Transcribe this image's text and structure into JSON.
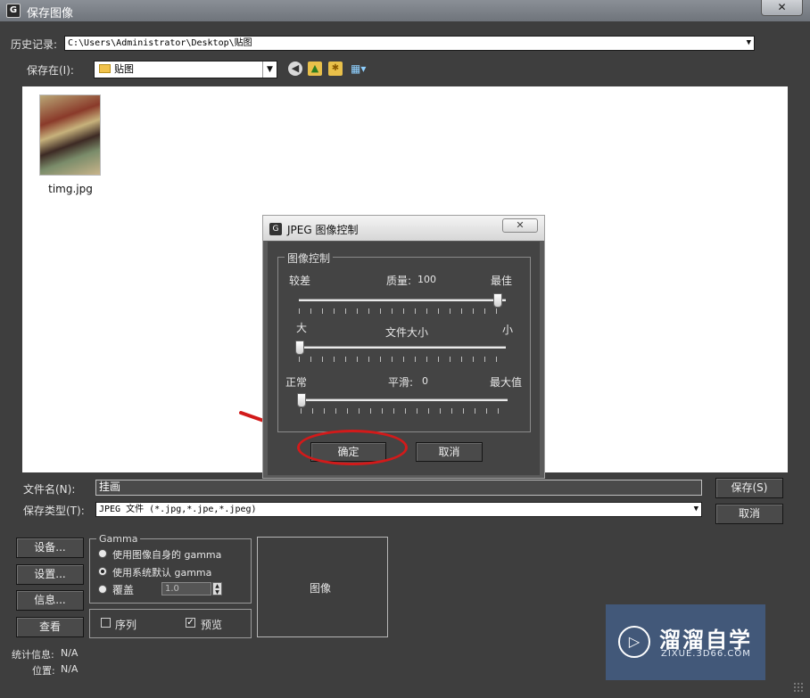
{
  "window": {
    "title": "保存图像",
    "close_glyph": "✕"
  },
  "history": {
    "label": "历史记录:",
    "value": "C:\\Users\\Administrator\\Desktop\\贴图"
  },
  "save_in": {
    "label": "保存在(I):",
    "value": "贴图"
  },
  "file": {
    "name": "timg.jpg"
  },
  "jpeg_dialog": {
    "title": "JPEG 图像控制",
    "close_glyph": "✕",
    "group_title": "图像控制",
    "quality": {
      "left_label": "较差",
      "center_label": "质量:",
      "value": "100",
      "right_label": "最佳",
      "level": 1.0
    },
    "size": {
      "left_label": "大",
      "center_label": "文件大小",
      "right_label": "小",
      "level": 0.0
    },
    "smooth": {
      "left_label": "正常",
      "center_label": "平滑:",
      "value": "0",
      "right_label": "最大值",
      "level": 0.0
    },
    "ok_label": "确定",
    "cancel_label": "取消"
  },
  "filename": {
    "label": "文件名(N):",
    "value": "挂画"
  },
  "filetype": {
    "label": "保存类型(T):",
    "value": "JPEG 文件 (*.jpg,*.jpe,*.jpeg)"
  },
  "buttons": {
    "save": "保存(S)",
    "cancel": "取消",
    "setup": "设备...",
    "settings": "设置...",
    "info": "信息...",
    "view": "查看"
  },
  "gamma": {
    "title": "Gamma",
    "own_label": "使用图像自身的 gamma",
    "default_label": "使用系统默认 gamma",
    "override_label": "覆盖",
    "override_value": "1.0",
    "selected": "default"
  },
  "sequence": {
    "label": "序列",
    "checked": false
  },
  "preview": {
    "label": "预览",
    "checked": true
  },
  "image_label": "图像",
  "stats": {
    "label": "统计信息:",
    "value": "N/A"
  },
  "location": {
    "label": "位置:",
    "value": "N/A"
  },
  "watermark": {
    "brand": "溜溜自学",
    "url": "ZIXUE.3D66.COM"
  }
}
